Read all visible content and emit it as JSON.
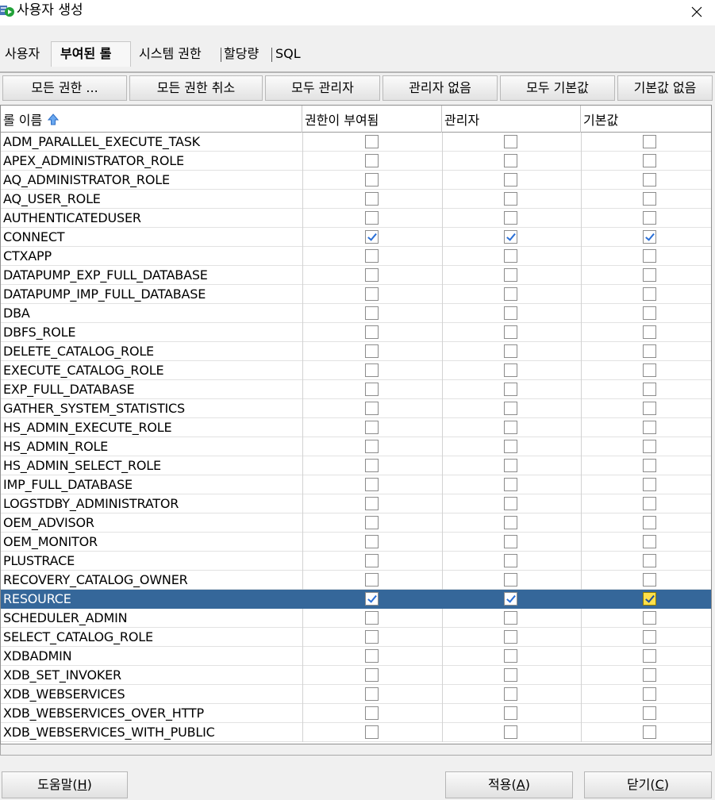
{
  "window": {
    "title": "사용자 생성",
    "close_glyph": "✕"
  },
  "tabs": [
    {
      "label": "사용자",
      "active": false
    },
    {
      "label": "부여된 롤",
      "active": true
    },
    {
      "label": "시스템 권한",
      "active": false
    },
    {
      "label": "할당량",
      "active": false
    },
    {
      "label": "SQL",
      "active": false
    }
  ],
  "toolbar": {
    "all_grant": "모든 권한 ...",
    "revoke_all": "모든 권한 취소",
    "all_admin": "모두 관리자",
    "no_admin": "관리자 없음",
    "all_default": "모두 기본값",
    "no_default": "기본값 없음"
  },
  "table": {
    "columns": {
      "role_name": "롤 이름",
      "granted": "권한이 부여됨",
      "admin": "관리자",
      "default": "기본값"
    },
    "sort_icon": "sort-ascending-arrow",
    "rows": [
      {
        "name": "ADM_PARALLEL_EXECUTE_TASK",
        "granted": false,
        "admin": false,
        "default": false
      },
      {
        "name": "APEX_ADMINISTRATOR_ROLE",
        "granted": false,
        "admin": false,
        "default": false
      },
      {
        "name": "AQ_ADMINISTRATOR_ROLE",
        "granted": false,
        "admin": false,
        "default": false
      },
      {
        "name": "AQ_USER_ROLE",
        "granted": false,
        "admin": false,
        "default": false
      },
      {
        "name": "AUTHENTICATEDUSER",
        "granted": false,
        "admin": false,
        "default": false
      },
      {
        "name": "CONNECT",
        "granted": true,
        "admin": true,
        "default": true
      },
      {
        "name": "CTXAPP",
        "granted": false,
        "admin": false,
        "default": false
      },
      {
        "name": "DATAPUMP_EXP_FULL_DATABASE",
        "granted": false,
        "admin": false,
        "default": false
      },
      {
        "name": "DATAPUMP_IMP_FULL_DATABASE",
        "granted": false,
        "admin": false,
        "default": false
      },
      {
        "name": "DBA",
        "granted": false,
        "admin": false,
        "default": false
      },
      {
        "name": "DBFS_ROLE",
        "granted": false,
        "admin": false,
        "default": false
      },
      {
        "name": "DELETE_CATALOG_ROLE",
        "granted": false,
        "admin": false,
        "default": false
      },
      {
        "name": "EXECUTE_CATALOG_ROLE",
        "granted": false,
        "admin": false,
        "default": false
      },
      {
        "name": "EXP_FULL_DATABASE",
        "granted": false,
        "admin": false,
        "default": false
      },
      {
        "name": "GATHER_SYSTEM_STATISTICS",
        "granted": false,
        "admin": false,
        "default": false
      },
      {
        "name": "HS_ADMIN_EXECUTE_ROLE",
        "granted": false,
        "admin": false,
        "default": false
      },
      {
        "name": "HS_ADMIN_ROLE",
        "granted": false,
        "admin": false,
        "default": false
      },
      {
        "name": "HS_ADMIN_SELECT_ROLE",
        "granted": false,
        "admin": false,
        "default": false
      },
      {
        "name": "IMP_FULL_DATABASE",
        "granted": false,
        "admin": false,
        "default": false
      },
      {
        "name": "LOGSTDBY_ADMINISTRATOR",
        "granted": false,
        "admin": false,
        "default": false
      },
      {
        "name": "OEM_ADVISOR",
        "granted": false,
        "admin": false,
        "default": false
      },
      {
        "name": "OEM_MONITOR",
        "granted": false,
        "admin": false,
        "default": false
      },
      {
        "name": "PLUSTRACE",
        "granted": false,
        "admin": false,
        "default": false
      },
      {
        "name": "RECOVERY_CATALOG_OWNER",
        "granted": false,
        "admin": false,
        "default": false
      },
      {
        "name": "RESOURCE",
        "granted": true,
        "admin": true,
        "default": true,
        "selected": true
      },
      {
        "name": "SCHEDULER_ADMIN",
        "granted": false,
        "admin": false,
        "default": false
      },
      {
        "name": "SELECT_CATALOG_ROLE",
        "granted": false,
        "admin": false,
        "default": false
      },
      {
        "name": "XDBADMIN",
        "granted": false,
        "admin": false,
        "default": false
      },
      {
        "name": "XDB_SET_INVOKER",
        "granted": false,
        "admin": false,
        "default": false
      },
      {
        "name": "XDB_WEBSERVICES",
        "granted": false,
        "admin": false,
        "default": false
      },
      {
        "name": "XDB_WEBSERVICES_OVER_HTTP",
        "granted": false,
        "admin": false,
        "default": false
      },
      {
        "name": "XDB_WEBSERVICES_WITH_PUBLIC",
        "granted": false,
        "admin": false,
        "default": false
      }
    ]
  },
  "footer": {
    "help": {
      "label": "도움말(",
      "key": "H",
      "suffix": ")"
    },
    "apply": {
      "label": "적용(",
      "key": "A",
      "suffix": ")"
    },
    "close": {
      "label": "닫기(",
      "key": "C",
      "suffix": ")"
    }
  },
  "colors": {
    "selection": "#35679a",
    "check": "#2a6fd6",
    "selected_focus_checkbox": "#ffe04a"
  }
}
